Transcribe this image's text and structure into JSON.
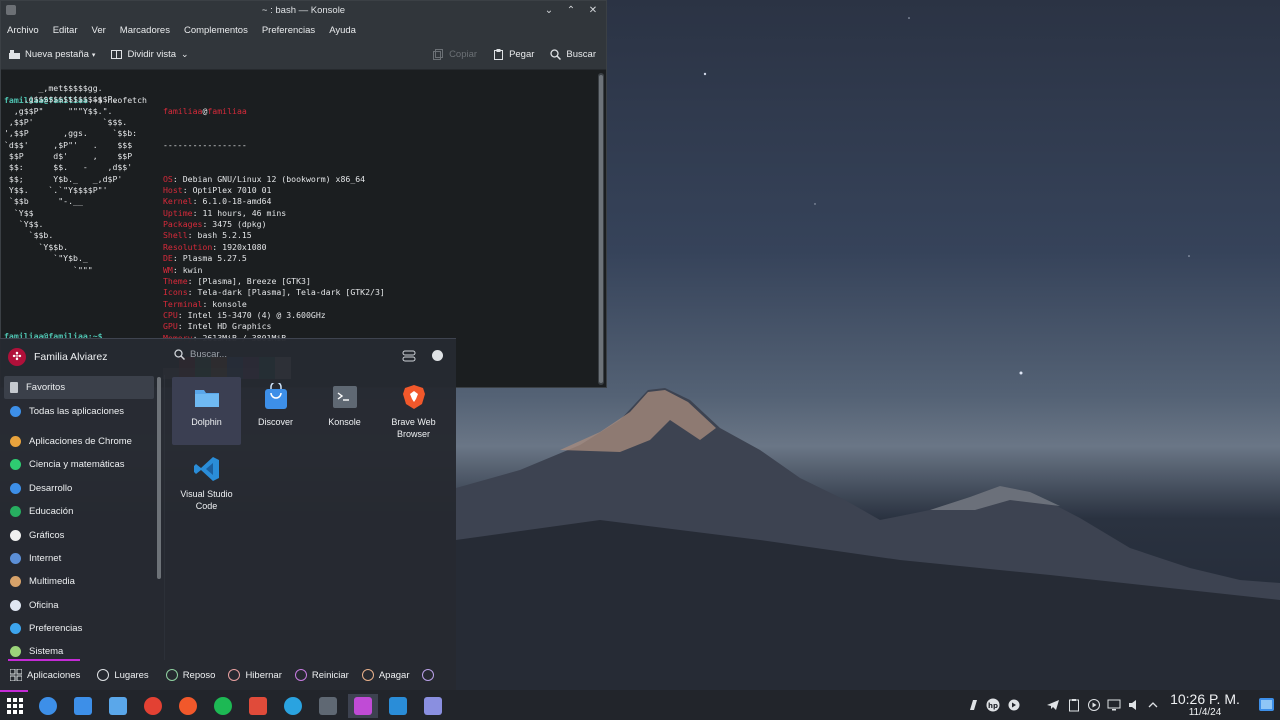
{
  "konsole": {
    "title": "~ : bash — Konsole",
    "menu": [
      "Archivo",
      "Editar",
      "Ver",
      "Marcadores",
      "Complementos",
      "Preferencias",
      "Ayuda"
    ],
    "toolbar": {
      "new_tab": "Nueva pestaña",
      "split_view": "Dividir vista",
      "copy": "Copiar",
      "paste": "Pegar",
      "search": "Buscar"
    },
    "prompt_user": "familiaa@familiaa",
    "prompt_rest": ":~$ neofetch",
    "info_user": "familiaa",
    "info_host": "familiaa",
    "info_sep": "-----------------",
    "info": [
      {
        "label": "OS",
        "value": "Debian GNU/Linux 12 (bookworm) x86_64"
      },
      {
        "label": "Host",
        "value": "OptiPlex 7010 01"
      },
      {
        "label": "Kernel",
        "value": "6.1.0-18-amd64"
      },
      {
        "label": "Uptime",
        "value": "11 hours, 46 mins"
      },
      {
        "label": "Packages",
        "value": "3475 (dpkg)"
      },
      {
        "label": "Shell",
        "value": "bash 5.2.15"
      },
      {
        "label": "Resolution",
        "value": "1920x1080"
      },
      {
        "label": "DE",
        "value": "Plasma 5.27.5"
      },
      {
        "label": "WM",
        "value": "kwin"
      },
      {
        "label": "Theme",
        "value": "[Plasma], Breeze [GTK3]"
      },
      {
        "label": "Icons",
        "value": "Tela-dark [Plasma], Tela-dark [GTK2/3]"
      },
      {
        "label": "Terminal",
        "value": "konsole"
      },
      {
        "label": "CPU",
        "value": "Intel i5-3470 (4) @ 3.600GHz"
      },
      {
        "label": "GPU",
        "value": "Intel HD Graphics"
      },
      {
        "label": "Memory",
        "value": "2613MiB / 3801MiB"
      }
    ],
    "ascii": [
      "       _,met$$$$$gg.",
      "    ,g$$$$$$$$$$$$$$$P.",
      "  ,g$$P\"     \"\"\"Y$$.\".",
      " ,$$P'              `$$$.",
      "',$$P       ,ggs.     `$$b:",
      "`d$$'     ,$P\"'   .    $$$",
      " $$P      d$'     ,    $$P",
      " $$:      $$.   -    ,d$$'",
      " $$;      Y$b._   _,d$P'",
      " Y$$.    `.`\"Y$$$$P\"'",
      " `$$b      \"-.__",
      "  `Y$$",
      "   `Y$$.",
      "     `$$b.",
      "       `Y$$b.",
      "          `\"Y$b._",
      "              `\"\"\""
    ],
    "swatch_colors": [
      "#1b1e20",
      "#e0161b",
      "#22c55e",
      "#f97316",
      "#1e88e5",
      "#a03cc3",
      "#14b8a6",
      "#f0f0f0",
      "#7a7f85",
      "#e03b3b",
      "#2ecc71",
      "#f5b041",
      "#3da5ee",
      "#c063d8",
      "#1abc9c",
      "#ffffff"
    ],
    "partial_prompt": "familiaa@familiaa:~$ "
  },
  "launcher": {
    "user_name": "Familia Alviarez",
    "search_placeholder": "Buscar...",
    "categories": [
      {
        "label": "Favoritos",
        "color": "#c5c9cf"
      },
      {
        "label": "Todas las aplicaciones",
        "color": "#3d8fe8"
      },
      {
        "label": "Aplicaciones de Chrome",
        "color": "#e8a33d"
      },
      {
        "label": "Ciencia y matemáticas",
        "color": "#2ecc71"
      },
      {
        "label": "Desarrollo",
        "color": "#3d8fe8"
      },
      {
        "label": "Educación",
        "color": "#27ae60"
      },
      {
        "label": "Gráficos",
        "color": "#f0f0f0"
      },
      {
        "label": "Internet",
        "color": "#5c8fd6"
      },
      {
        "label": "Multimedia",
        "color": "#d7a26a"
      },
      {
        "label": "Oficina",
        "color": "#dfe6f2"
      },
      {
        "label": "Preferencias",
        "color": "#3da5ee"
      },
      {
        "label": "Sistema",
        "color": "#9bd37a"
      }
    ],
    "apps": [
      {
        "label": "Dolphin",
        "icon": "folder-icon",
        "color": "#5aa7ea"
      },
      {
        "label": "Discover",
        "icon": "bag-icon",
        "color": "#3d8fe8"
      },
      {
        "label": "Konsole",
        "icon": "terminal-icon",
        "color": "#5f6873"
      },
      {
        "label": "Brave Web Browser",
        "icon": "brave-icon",
        "color": "#f1582b"
      },
      {
        "label": "Visual Studio Code",
        "icon": "vscode-icon",
        "color": "#2a8dd8"
      }
    ],
    "footer": {
      "apps": "Aplicaciones",
      "places": "Lugares",
      "sleep": "Reposo",
      "hibernate": "Hibernar",
      "restart": "Reiniciar",
      "shutdown": "Apagar"
    }
  },
  "taskbar": {
    "apps": [
      {
        "name": "app-launcher-icon",
        "color": "#ffffff"
      },
      {
        "name": "mountain-icon",
        "color": "#3d8fe8"
      },
      {
        "name": "discover-icon",
        "color": "#3d8fe8"
      },
      {
        "name": "dolphin-icon",
        "color": "#5aa7ea"
      },
      {
        "name": "chrome-icon",
        "color": "#e34133"
      },
      {
        "name": "brave-icon",
        "color": "#f1582b"
      },
      {
        "name": "spotify-icon",
        "color": "#1db954"
      },
      {
        "name": "office-icon",
        "color": "#e04b3a"
      },
      {
        "name": "telegram-icon",
        "color": "#2aa3e0"
      },
      {
        "name": "konsole-icon",
        "color": "#5f6873"
      },
      {
        "name": "image-viewer-icon",
        "color": "#c04bd6"
      },
      {
        "name": "vscode-icon",
        "color": "#2a8dd8"
      },
      {
        "name": "remote-icon",
        "color": "#8a8fe0"
      }
    ],
    "time": "10:26 P. M.",
    "date": "11/4/24"
  }
}
